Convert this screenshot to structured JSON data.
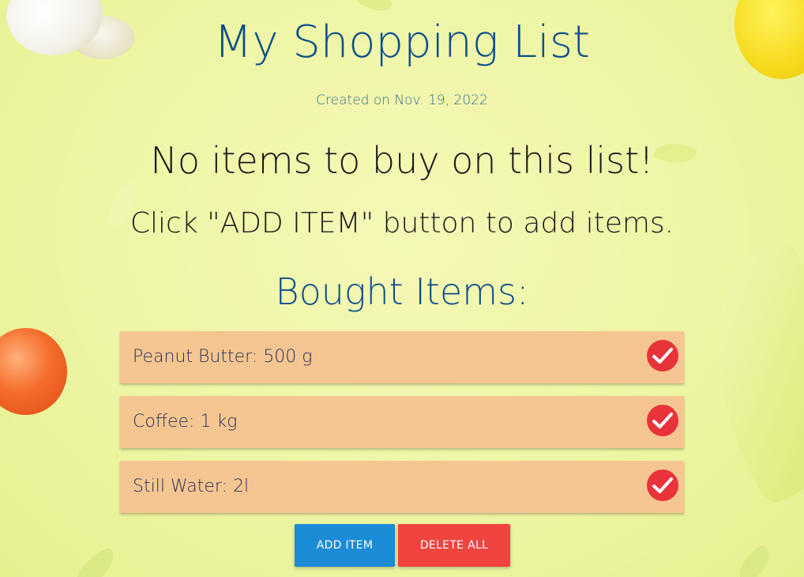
{
  "header": {
    "title": "My Shopping List",
    "created": "Created on Nov. 19, 2022"
  },
  "to_buy": {
    "empty_message": "No items to buy on this list!",
    "hint": "Click \"ADD ITEM\" button to add items."
  },
  "bought": {
    "heading": "Bought Items:",
    "items": [
      {
        "label": "Peanut Butter: 500 g"
      },
      {
        "label": "Coffee: 1 kg"
      },
      {
        "label": "Still Water: 2l"
      }
    ]
  },
  "actions": {
    "add_label": "ADD ITEM",
    "delete_all_label": "DELETE ALL"
  },
  "colors": {
    "title": "#0d4f8b",
    "item_background": "#f5c691",
    "check_button": "#e8333a",
    "add_button": "#1b8bd6",
    "delete_button": "#f1433f"
  },
  "icons": {
    "item_action": "check-circle-icon"
  }
}
